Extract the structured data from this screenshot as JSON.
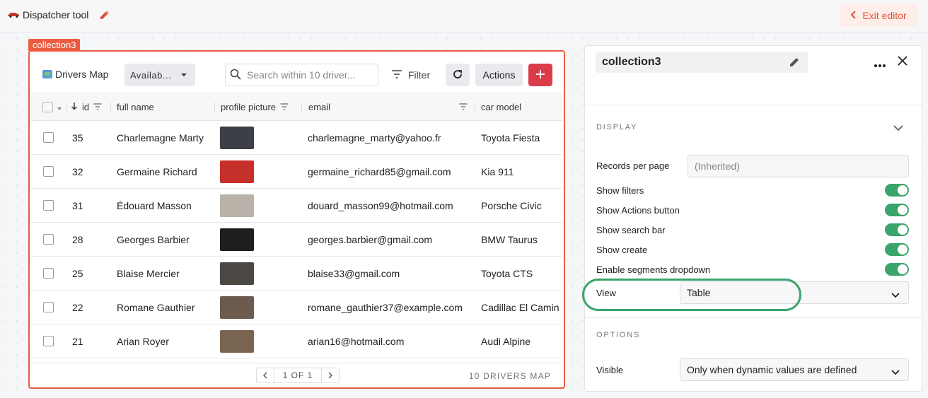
{
  "app": {
    "title": "Dispatcher tool",
    "exit_label": "Exit editor"
  },
  "collection": {
    "tag": "collection3",
    "toolbar": {
      "title": "Drivers Map",
      "segment_value": "Availab...",
      "search_placeholder": "Search within 10 driver...",
      "filter_label": "Filter",
      "actions_label": "Actions"
    },
    "columns": [
      "id",
      "full name",
      "profile picture",
      "email",
      "car model"
    ],
    "rows": [
      {
        "id": "35",
        "name": "Charlemagne Marty",
        "email": "charlemagne_marty@yahoo.fr",
        "car": "Toyota Fiesta",
        "thumb": "#3c3f45"
      },
      {
        "id": "32",
        "name": "Germaine Richard",
        "email": "germaine_richard85@gmail.com",
        "car": "Kia 911",
        "thumb": "#c6302b"
      },
      {
        "id": "31",
        "name": "Édouard Masson",
        "email": "douard_masson99@hotmail.com",
        "car": "Porsche Civic",
        "thumb": "#b9b2a8"
      },
      {
        "id": "28",
        "name": "Georges Barbier",
        "email": "georges.barbier@gmail.com",
        "car": "BMW Taurus",
        "thumb": "#1e1e20"
      },
      {
        "id": "25",
        "name": "Blaise Mercier",
        "email": "blaise33@gmail.com",
        "car": "Toyota CTS",
        "thumb": "#4b4742"
      },
      {
        "id": "22",
        "name": "Romane Gauthier",
        "email": "romane_gauthier37@example.com",
        "car": "Cadillac El Camin",
        "thumb": "#6b5a4e"
      },
      {
        "id": "21",
        "name": "Arian Royer",
        "email": "arian16@hotmail.com",
        "car": "Audi Alpine",
        "thumb": "#7a6552"
      }
    ],
    "pager": {
      "text": "1 OF 1"
    },
    "records_count": "10 DRIVERS MAP"
  },
  "panel": {
    "name": "collection3",
    "display_title": "DISPLAY",
    "records_per_page_label": "Records per page",
    "records_per_page_placeholder": "(Inherited)",
    "toggles": [
      {
        "label": "Show filters",
        "on": true
      },
      {
        "label": "Show Actions button",
        "on": true
      },
      {
        "label": "Show search bar",
        "on": true
      },
      {
        "label": "Show create",
        "on": true
      },
      {
        "label": "Enable segments dropdown",
        "on": true
      }
    ],
    "view_label": "View",
    "view_value": "Table",
    "options_title": "OPTIONS",
    "visible_label": "Visible",
    "visible_value": "Only when dynamic values are defined"
  },
  "colors": {
    "accent": "#ec5b3f",
    "toggle_on": "#3aa56b",
    "add_button": "#dc3c4a"
  }
}
